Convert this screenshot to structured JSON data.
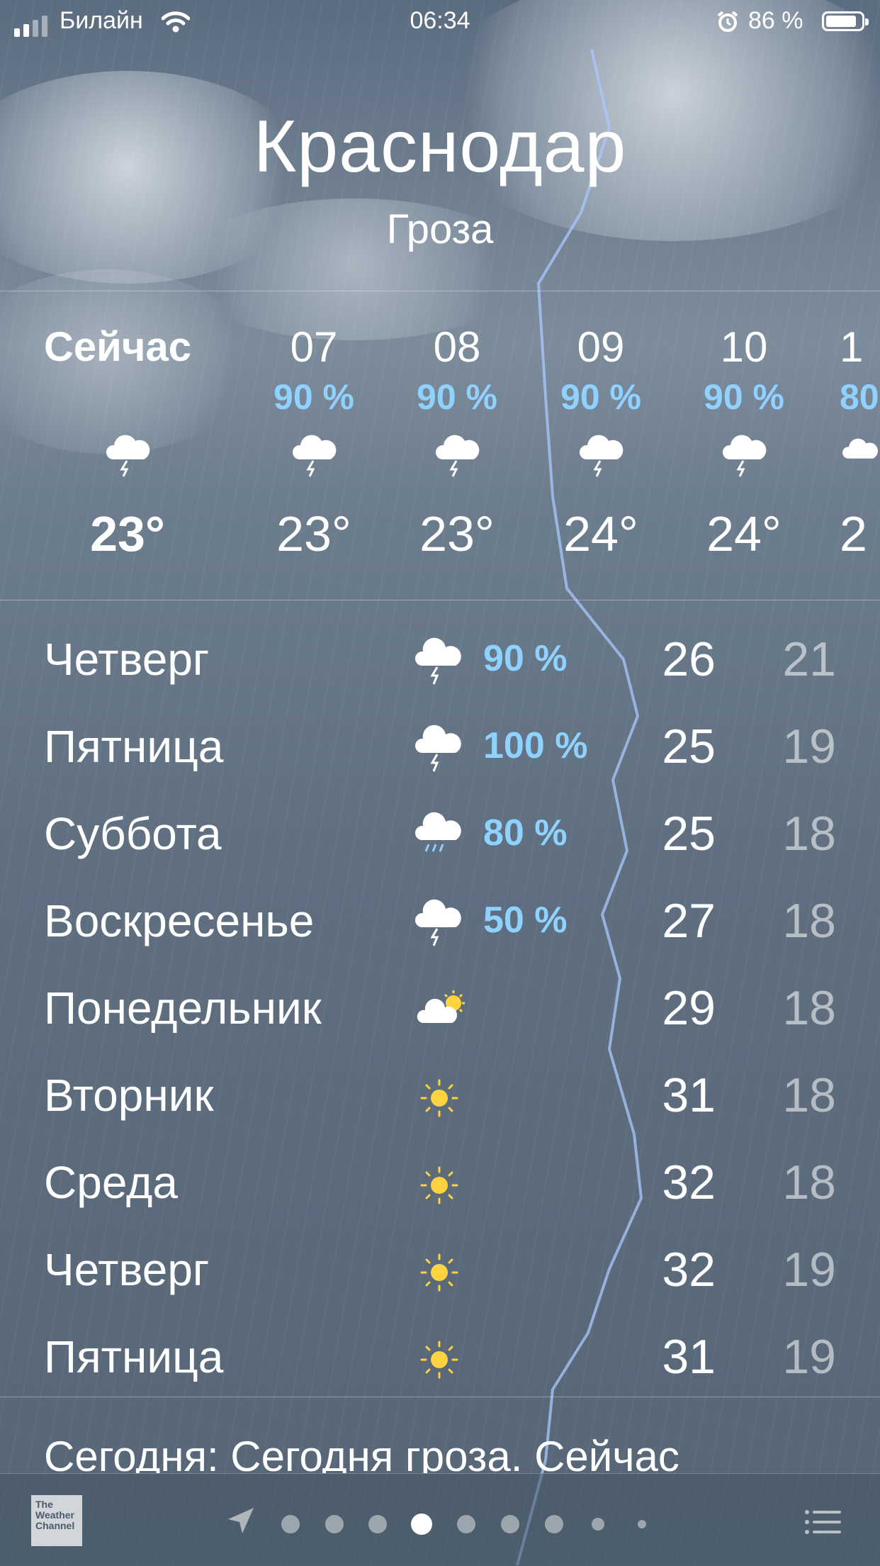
{
  "status_bar": {
    "carrier": "Билайн",
    "time": "06:34",
    "battery": "86 %"
  },
  "header": {
    "city": "Краснодар",
    "condition": "Гроза"
  },
  "hourly": [
    {
      "time": "Сейчас",
      "pop": "",
      "icon": "thunderstorm-icon",
      "temp": "23°"
    },
    {
      "time": "07",
      "pop": "90 %",
      "icon": "thunderstorm-icon",
      "temp": "23°"
    },
    {
      "time": "08",
      "pop": "90 %",
      "icon": "thunderstorm-icon",
      "temp": "23°"
    },
    {
      "time": "09",
      "pop": "90 %",
      "icon": "thunderstorm-icon",
      "temp": "24°"
    },
    {
      "time": "10",
      "pop": "90 %",
      "icon": "thunderstorm-icon",
      "temp": "24°"
    },
    {
      "time": "1",
      "pop": "80",
      "icon": "thunderstorm-icon",
      "temp": "2"
    }
  ],
  "daily": [
    {
      "day": "Четверг",
      "icon": "thunderstorm-icon",
      "pop": "90 %",
      "high": "26",
      "low": "21"
    },
    {
      "day": "Пятница",
      "icon": "thunderstorm-icon",
      "pop": "100 %",
      "high": "25",
      "low": "19"
    },
    {
      "day": "Суббота",
      "icon": "rain-icon",
      "pop": "80 %",
      "high": "25",
      "low": "18"
    },
    {
      "day": "Воскресенье",
      "icon": "thunderstorm-icon",
      "pop": "50 %",
      "high": "27",
      "low": "18"
    },
    {
      "day": "Понедельник",
      "icon": "partly-cloudy-icon",
      "pop": "",
      "high": "29",
      "low": "18"
    },
    {
      "day": "Вторник",
      "icon": "sun-icon",
      "pop": "",
      "high": "31",
      "low": "18"
    },
    {
      "day": "Среда",
      "icon": "sun-icon",
      "pop": "",
      "high": "32",
      "low": "18"
    },
    {
      "day": "Четверг",
      "icon": "sun-icon",
      "pop": "",
      "high": "32",
      "low": "19"
    },
    {
      "day": "Пятница",
      "icon": "sun-icon",
      "pop": "",
      "high": "31",
      "low": "19"
    }
  ],
  "summary": "Сегодня: Сегодня гроза. Сейчас",
  "bottom_bar": {
    "logo_text": "The Weather Channel",
    "page_count": 9,
    "active_page": 4
  },
  "colors": {
    "precip": "#8fd1ff",
    "sun": "#ffd23f"
  }
}
